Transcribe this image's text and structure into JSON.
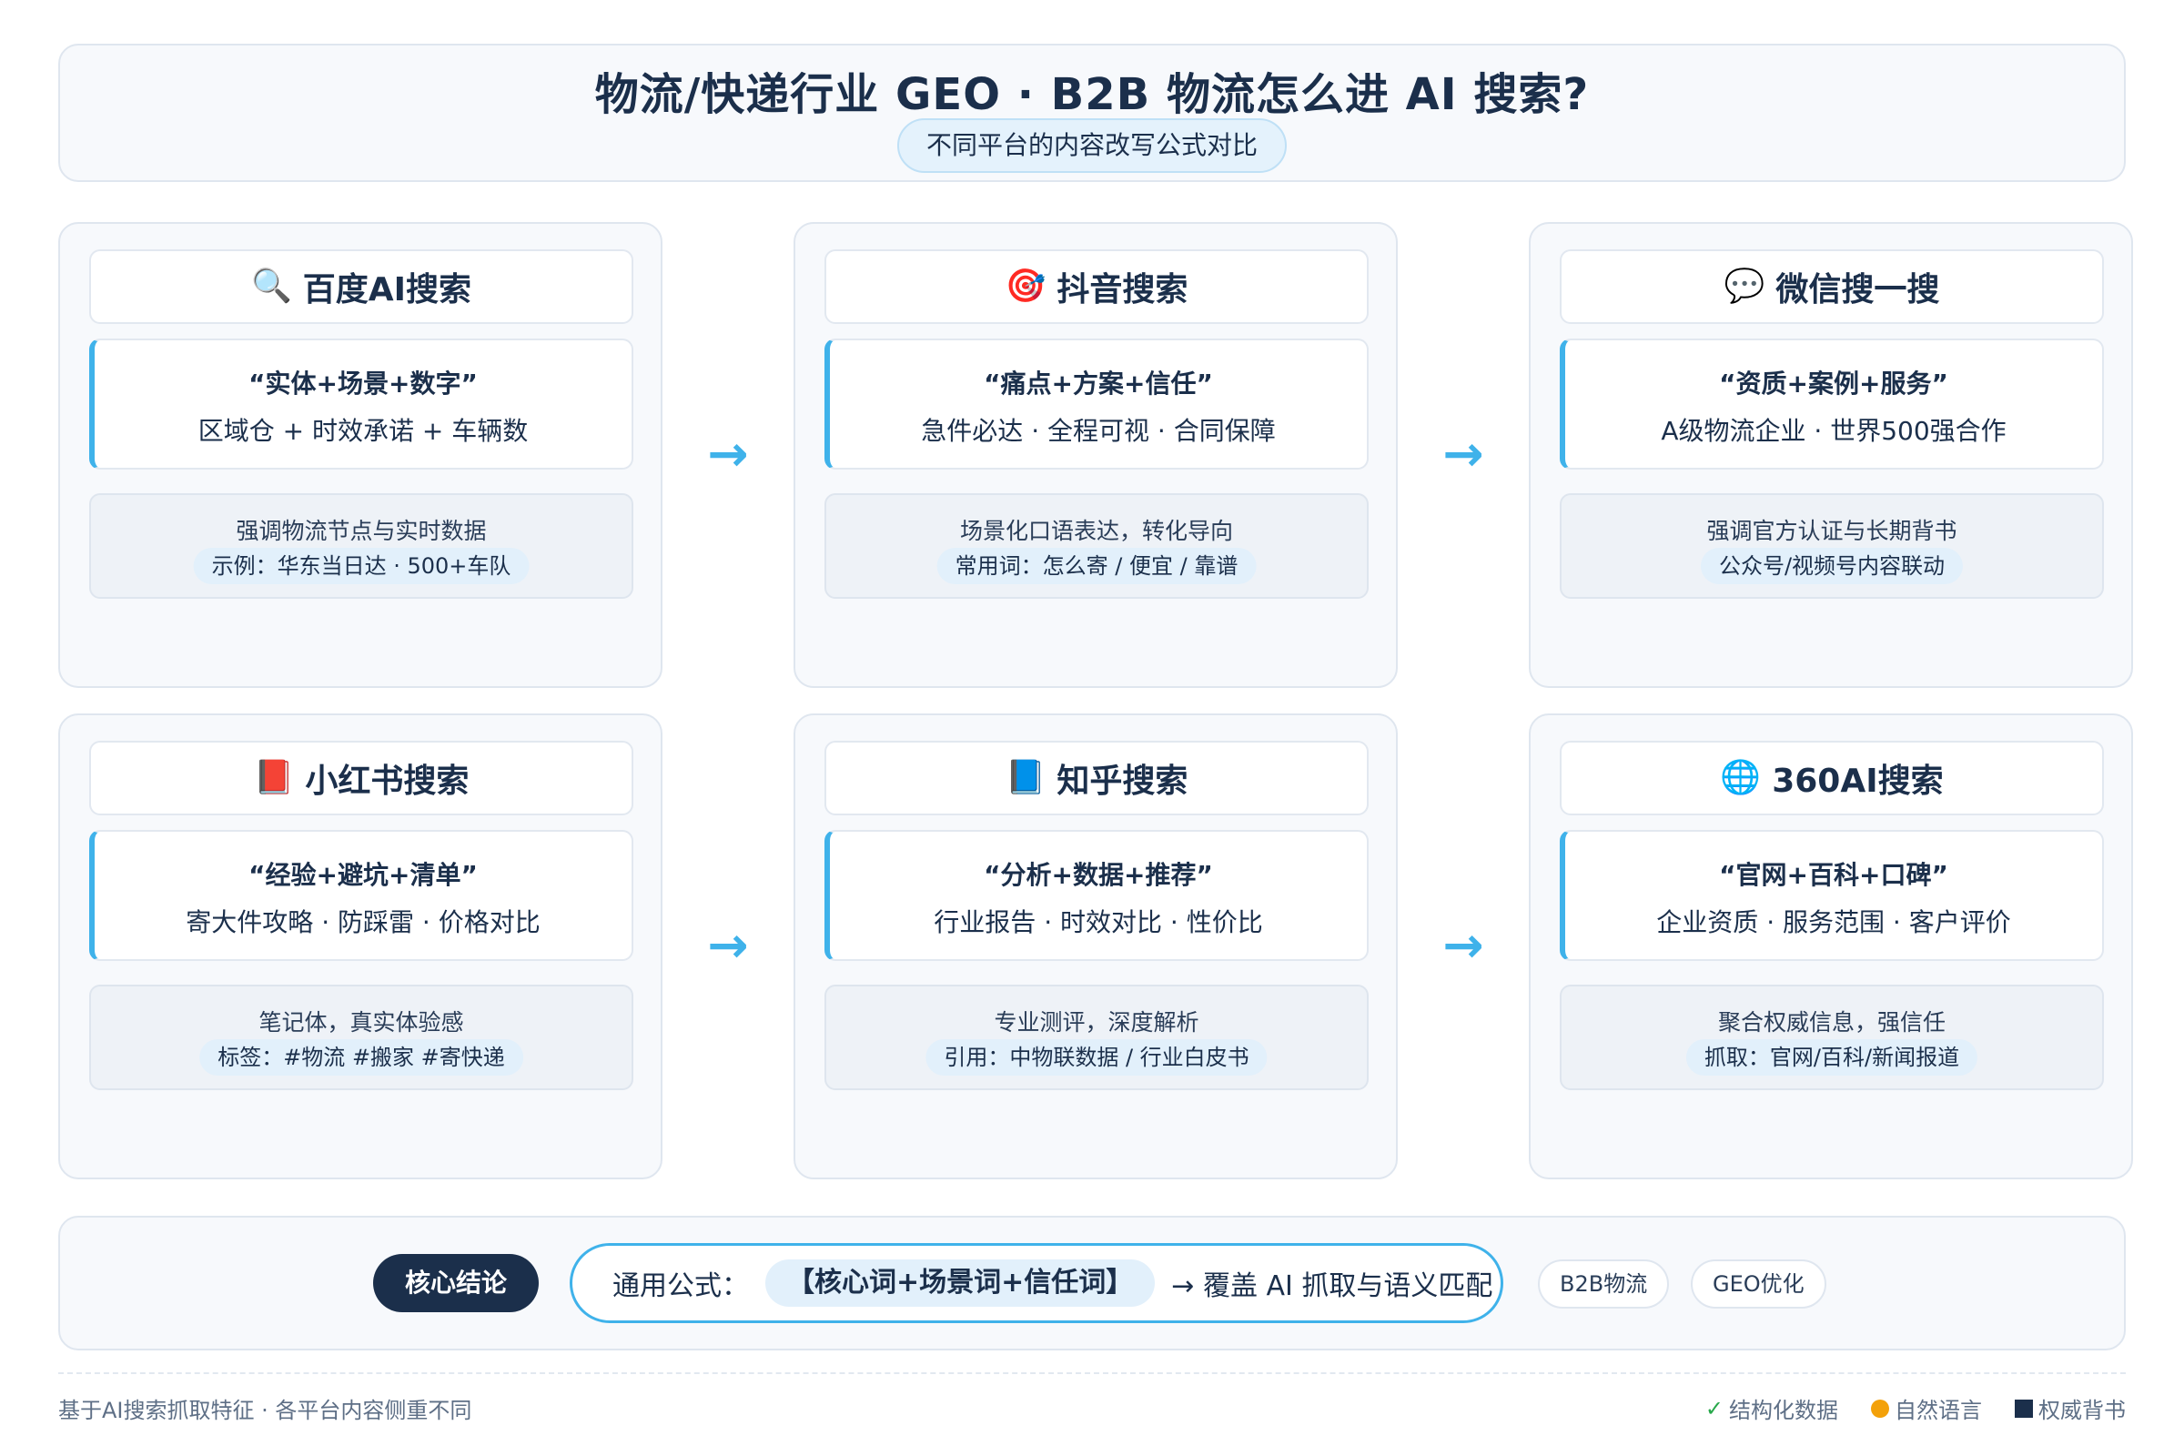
{
  "header": {
    "title": "物流/快递行业 GEO · B2B 物流怎么进 AI 搜索?",
    "subtitle": "不同平台的内容改写公式对比"
  },
  "platforms": [
    {
      "icon": "🔍",
      "icon_name": "magnifier-icon",
      "name": "百度AI搜索",
      "formula": "“实体+场景+数字”",
      "elements": "区域仓 + 时效承诺 + 车辆数",
      "note": "强调物流节点与实时数据",
      "example": "示例：华东当日达 · 500+车队"
    },
    {
      "icon": "🎯",
      "icon_name": "target-icon",
      "name": "抖音搜索",
      "formula": "“痛点+方案+信任”",
      "elements": "急件必达 · 全程可视 · 合同保障",
      "note": "场景化口语表达，转化导向",
      "example": "常用词：怎么寄 / 便宜 / 靠谱"
    },
    {
      "icon": "💬",
      "icon_name": "speech-bubble-icon",
      "name": "微信搜一搜",
      "formula": "“资质+案例+服务”",
      "elements": "A级物流企业 · 世界500强合作",
      "note": "强调官方认证与长期背书",
      "example": "公众号/视频号内容联动"
    },
    {
      "icon": "📕",
      "icon_name": "red-book-icon",
      "name": "小红书搜索",
      "formula": "“经验+避坑+清单”",
      "elements": "寄大件攻略 · 防踩雷 · 价格对比",
      "note": "笔记体，真实体验感",
      "example": "标签：#物流 #搬家 #寄快递"
    },
    {
      "icon": "📘",
      "icon_name": "blue-book-icon",
      "name": "知乎搜索",
      "formula": "“分析+数据+推荐”",
      "elements": "行业报告 · 时效对比 · 性价比",
      "note": "专业测评，深度解析",
      "example": "引用：中物联数据 / 行业白皮书"
    },
    {
      "icon": "🌐",
      "icon_name": "globe-icon",
      "name": "360AI搜索",
      "formula": "“官网+百科+口碑”",
      "elements": "企业资质 · 服务范围 · 客户评价",
      "note": "聚合权威信息，强信任",
      "example": "抓取：官网/百科/新闻报道"
    }
  ],
  "arrow_glyph": "→",
  "conclusion": {
    "label": "核心结论",
    "formula_label": "通用公式：",
    "formula_highlight": "【核心词+场景词+信任词】",
    "formula_result": "→ 覆盖 AI 抓取与语义匹配",
    "tags": [
      "B2B物流",
      "GEO优化"
    ]
  },
  "footer": {
    "note": "基于AI搜索抓取特征 · 各平台内容侧重不同",
    "legend": [
      {
        "label": "结构化数据",
        "icon_name": "check-icon",
        "color": "#27a84a"
      },
      {
        "label": "自然语言",
        "icon_name": "orange-dot-icon",
        "color": "#f3a10a"
      },
      {
        "label": "权威背书",
        "icon_name": "navy-square-icon",
        "color": "#1b2f4b"
      }
    ]
  },
  "colors": {
    "accent": "#3fb2ea",
    "navy": "#1b2f4b",
    "card_bg": "#f7f9fc"
  }
}
